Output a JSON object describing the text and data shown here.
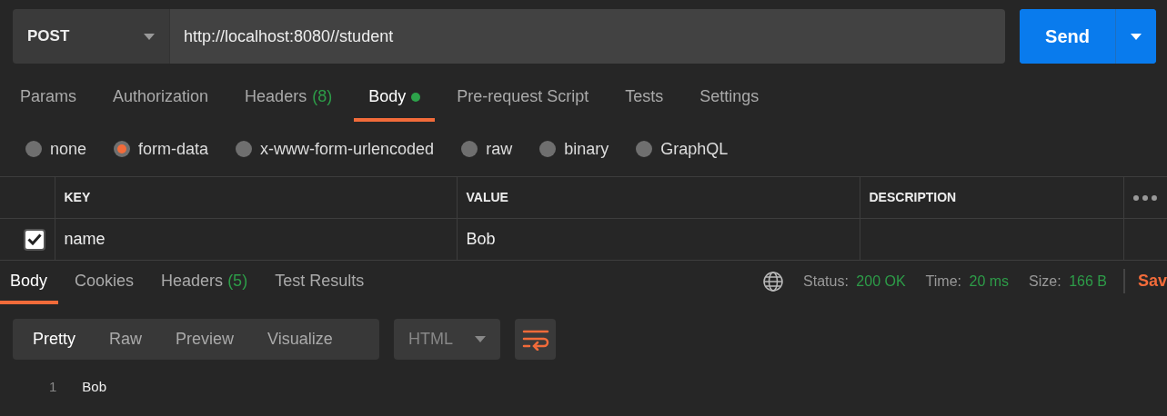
{
  "request": {
    "method": "POST",
    "url": "http://localhost:8080//student",
    "send_label": "Send"
  },
  "request_tabs": [
    {
      "label": "Params",
      "selected": false
    },
    {
      "label": "Authorization",
      "selected": false
    },
    {
      "label": "Headers",
      "count": "(8)",
      "selected": false
    },
    {
      "label": "Body",
      "selected": true,
      "has_content": true
    },
    {
      "label": "Pre-request Script",
      "selected": false
    },
    {
      "label": "Tests",
      "selected": false
    },
    {
      "label": "Settings",
      "selected": false
    }
  ],
  "body_types": [
    {
      "label": "none",
      "selected": false
    },
    {
      "label": "form-data",
      "selected": true
    },
    {
      "label": "x-www-form-urlencoded",
      "selected": false
    },
    {
      "label": "raw",
      "selected": false
    },
    {
      "label": "binary",
      "selected": false
    },
    {
      "label": "GraphQL",
      "selected": false
    }
  ],
  "params_table": {
    "columns": [
      "KEY",
      "VALUE",
      "DESCRIPTION"
    ],
    "rows": [
      {
        "checked": true,
        "key": "name",
        "value": "Bob"
      }
    ]
  },
  "response_tabs": [
    {
      "label": "Body",
      "selected": true
    },
    {
      "label": "Cookies",
      "selected": false
    },
    {
      "label": "Headers",
      "count": "(5)",
      "selected": false
    },
    {
      "label": "Test Results",
      "selected": false
    }
  ],
  "response_meta": [
    {
      "label": "Status:",
      "value": "200 OK"
    },
    {
      "label": "Time:",
      "value": "20 ms"
    },
    {
      "label": "Size:",
      "value": "166 B"
    }
  ],
  "save_label": "Sav",
  "view_modes": [
    {
      "label": "Pretty",
      "selected": true
    },
    {
      "label": "Raw",
      "selected": false
    },
    {
      "label": "Preview",
      "selected": false
    },
    {
      "label": "Visualize",
      "selected": false
    }
  ],
  "format": "HTML",
  "code_lines": [
    {
      "number": "1",
      "text": "Bob"
    }
  ]
}
